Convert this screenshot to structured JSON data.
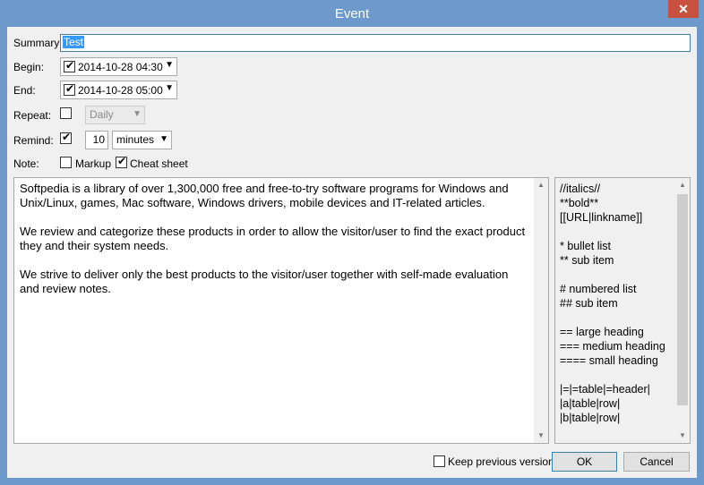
{
  "window": {
    "title": "Event",
    "close_glyph": "✕"
  },
  "form": {
    "summary": {
      "label": "Summary:",
      "value": "Test"
    },
    "begin": {
      "label": "Begin:",
      "checked": true,
      "value": "2014-10-28 04:30"
    },
    "end": {
      "label": "End:",
      "checked": true,
      "value": "2014-10-28 05:00"
    },
    "repeat": {
      "label": "Repeat:",
      "checked": false,
      "option": "Daily"
    },
    "remind": {
      "label": "Remind:",
      "checked": true,
      "amount": "10",
      "unit": "minutes"
    },
    "note": {
      "label": "Note:",
      "markup_label": "Markup",
      "markup_checked": false,
      "cheat_label": "Cheat sheet",
      "cheat_checked": true
    }
  },
  "note_text": [
    "Softpedia is a library of over 1,300,000 free and free-to-try software programs for Windows and Unix/Linux, games, Mac software, Windows drivers, mobile devices and IT-related articles.",
    "We review and categorize these products in order to allow the visitor/user to find the exact product they and their system needs.",
    "We strive to deliver only the best products to the visitor/user together with self-made evaluation and review notes."
  ],
  "cheat_sheet": [
    "//italics//",
    "**bold**",
    "[[URL|linkname]]",
    "",
    "* bullet list",
    "** sub item",
    "",
    "# numbered list",
    "## sub item",
    "",
    "== large heading",
    "=== medium heading",
    "==== small heading",
    "",
    "|=|=table|=header|",
    "|a|table|row|",
    "|b|table|row|"
  ],
  "footer": {
    "keep_previous_label": "Keep previous version",
    "keep_previous_checked": false,
    "ok_label": "OK",
    "cancel_label": "Cancel"
  },
  "icons": {
    "check": "check-icon",
    "dropdown": "chevron-down-icon",
    "scroll_up": "scroll-up-icon",
    "scroll_down": "scroll-down-icon"
  }
}
